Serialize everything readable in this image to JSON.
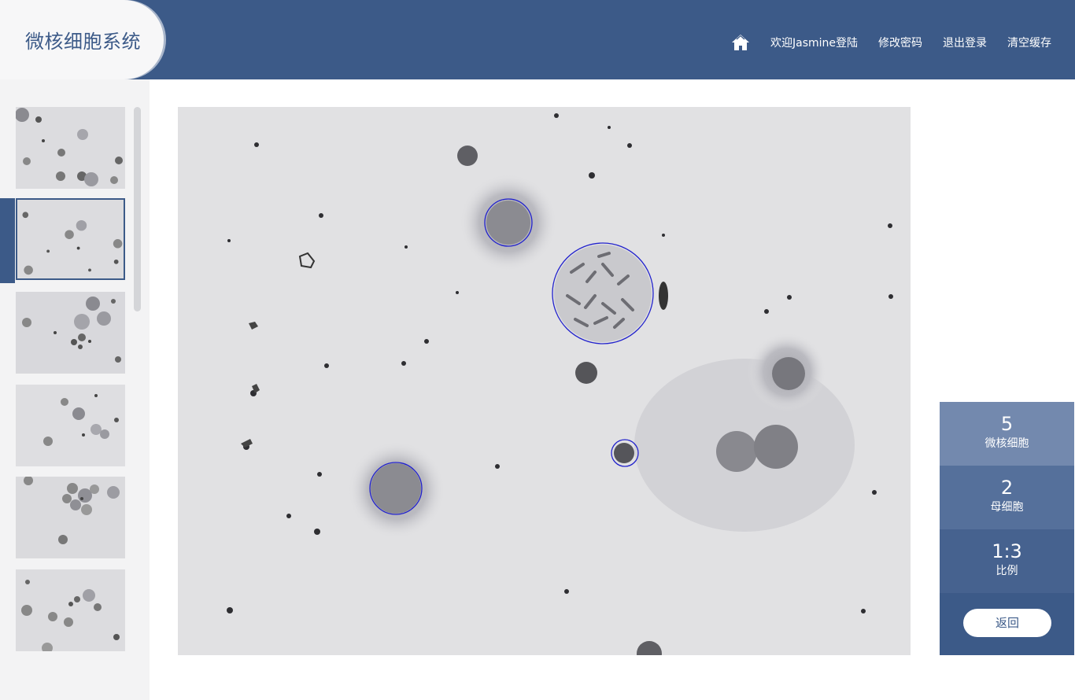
{
  "app": {
    "title": "微核细胞系统"
  },
  "nav": {
    "home_icon": "home-icon",
    "welcome": "欢迎Jasmine登陆",
    "change_password": "修改密码",
    "logout": "退出登录",
    "clear_cache": "清空缓存"
  },
  "sidebar": {
    "selected_index": 1,
    "thumbnails": [
      "thumbnail-1",
      "thumbnail-2",
      "thumbnail-3",
      "thumbnail-4",
      "thumbnail-5",
      "thumbnail-6"
    ]
  },
  "main": {
    "annotation_color": "#2222cc"
  },
  "stats": {
    "micronucleus": {
      "value": "5",
      "label": "微核细胞"
    },
    "mother": {
      "value": "2",
      "label": "母细胞"
    },
    "ratio": {
      "value": "1:3",
      "label": "比例"
    }
  },
  "actions": {
    "back": "返回"
  },
  "colors": {
    "primary": "#3c5a88",
    "stat_1": "#7389ae",
    "stat_2": "#55709b",
    "stat_3": "#46628f"
  }
}
